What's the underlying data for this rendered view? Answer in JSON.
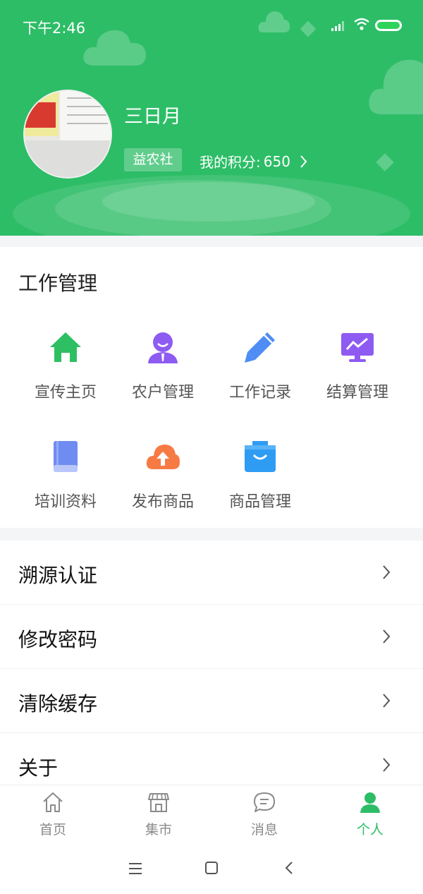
{
  "status_bar": {
    "time": "下午2:46"
  },
  "profile": {
    "name": "三日月",
    "badge": "益农社",
    "points_label": "我的积分:",
    "points_value": "650"
  },
  "work": {
    "title": "工作管理",
    "items": [
      {
        "label": "宣传主页",
        "icon": "home-icon"
      },
      {
        "label": "农户管理",
        "icon": "farmer-icon"
      },
      {
        "label": "工作记录",
        "icon": "pencil-icon"
      },
      {
        "label": "结算管理",
        "icon": "monitor-chart-icon"
      },
      {
        "label": "培训资料",
        "icon": "book-icon"
      },
      {
        "label": "发布商品",
        "icon": "cloud-upload-icon"
      },
      {
        "label": "商品管理",
        "icon": "bag-icon"
      }
    ]
  },
  "menu": [
    {
      "label": "溯源认证"
    },
    {
      "label": "修改密码"
    },
    {
      "label": "清除缓存"
    },
    {
      "label": "关于"
    }
  ],
  "tabs": [
    {
      "label": "首页",
      "icon": "home-outline-icon"
    },
    {
      "label": "集市",
      "icon": "store-icon"
    },
    {
      "label": "消息",
      "icon": "chat-icon"
    },
    {
      "label": "个人",
      "icon": "person-icon",
      "active": true
    }
  ],
  "colors": {
    "primary": "#2dbd67",
    "background": "#f4f5f6"
  }
}
